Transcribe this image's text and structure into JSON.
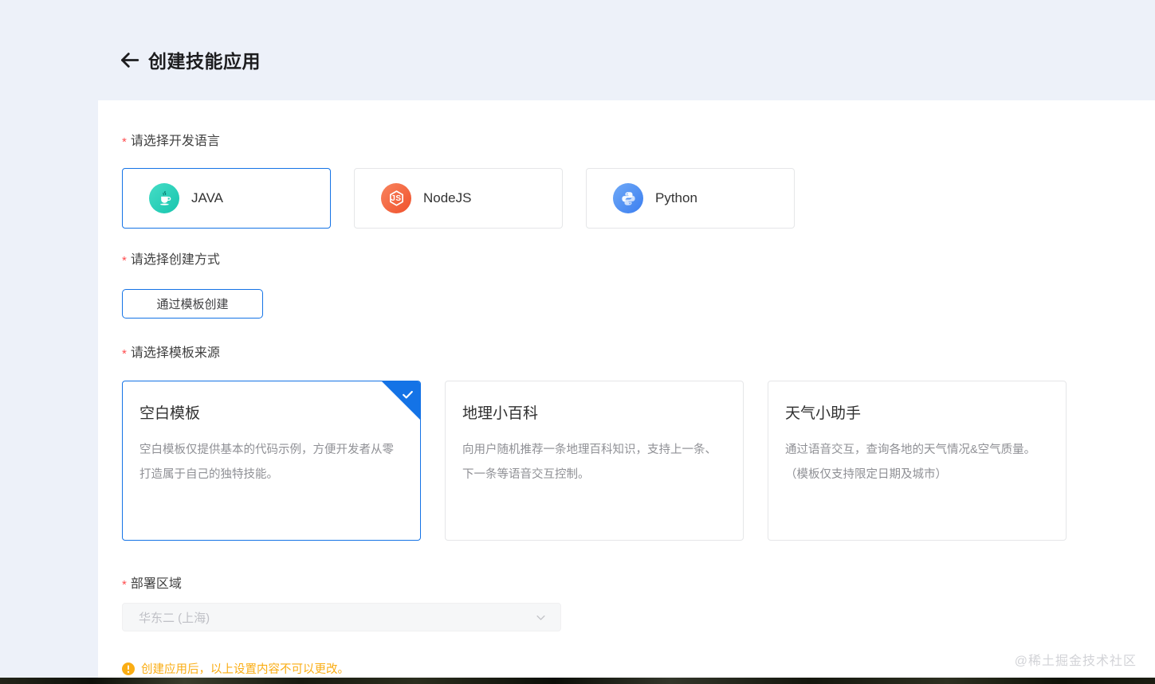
{
  "page": {
    "title": "创建技能应用",
    "watermark": "@稀土掘金技术社区"
  },
  "form": {
    "required_mark": "*",
    "language": {
      "label": "请选择开发语言",
      "options": [
        {
          "label": "JAVA",
          "icon": "java-icon",
          "selected": true
        },
        {
          "label": "NodeJS",
          "icon": "nodejs-icon",
          "icon_text": "JS",
          "selected": false
        },
        {
          "label": "Python",
          "icon": "python-icon",
          "selected": false
        }
      ]
    },
    "creation_method": {
      "label": "请选择创建方式",
      "options": [
        {
          "label": "通过模板创建",
          "selected": true
        }
      ]
    },
    "template_source": {
      "label": "请选择模板来源",
      "options": [
        {
          "title": "空白模板",
          "description": "空白模板仅提供基本的代码示例，方便开发者从零打造属于自己的独特技能。",
          "selected": true
        },
        {
          "title": "地理小百科",
          "description": "向用户随机推荐一条地理百科知识，支持上一条、下一条等语音交互控制。",
          "selected": false
        },
        {
          "title": "天气小助手",
          "description": "通过语音交互，查询各地的天气情况&空气质量。（模板仅支持限定日期及城市）",
          "selected": false
        }
      ]
    },
    "region": {
      "label": "部署区域",
      "value": "华东二 (上海)",
      "disabled": true
    },
    "notice": "创建应用后，以上设置内容不可以更改。"
  },
  "colors": {
    "accent_blue": "#1473e6",
    "warning_orange": "#faad14",
    "required_red": "#ff4d4f",
    "java_teal": "#1cc9b2",
    "nodejs_orange": "#f2552d",
    "python_blue": "#3f82f2",
    "page_background": "#edf1f9",
    "panel_background": "#ffffff"
  }
}
